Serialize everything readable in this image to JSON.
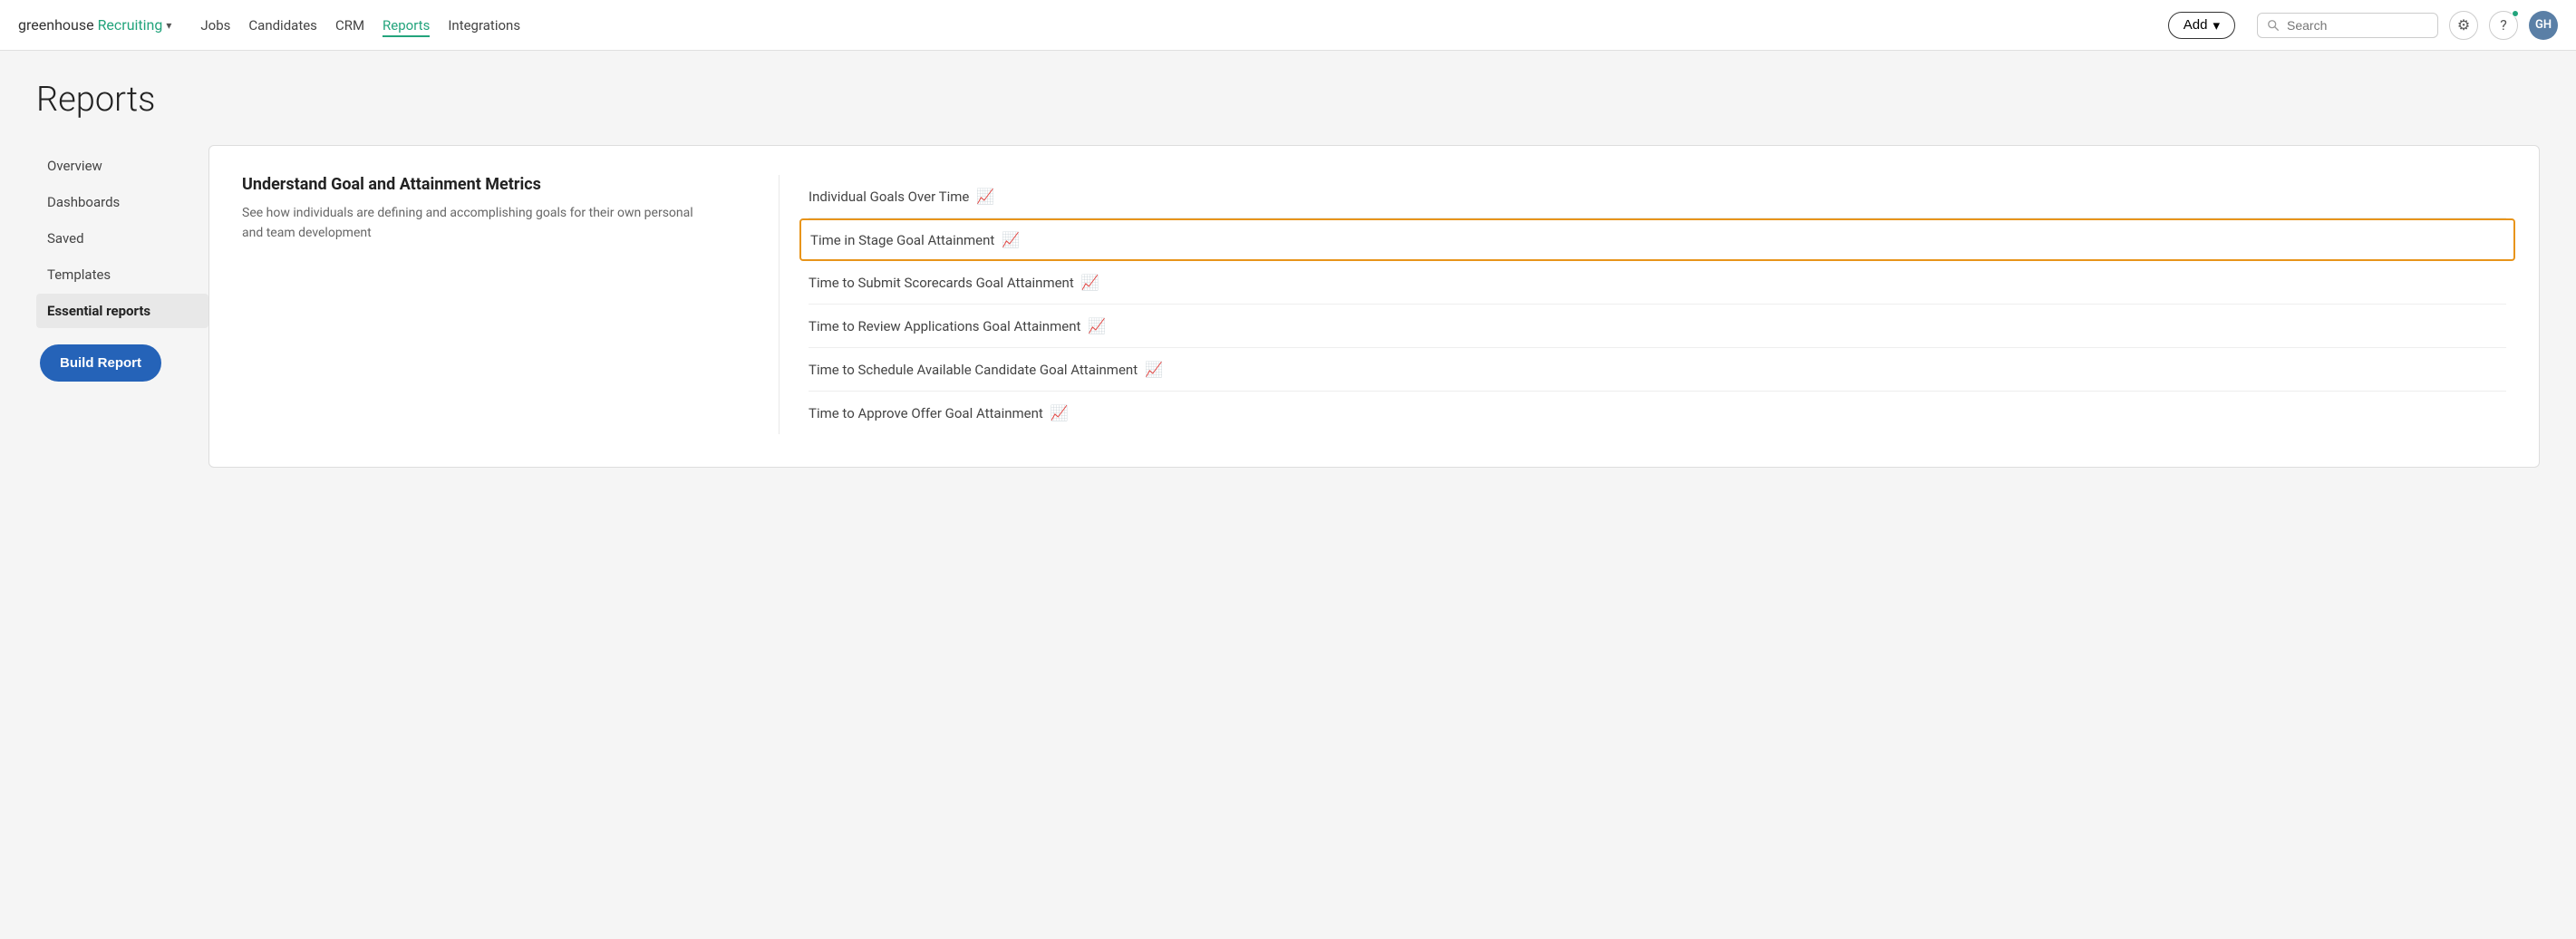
{
  "app": {
    "logo_greenhouse": "greenhouse",
    "logo_recruiting": "Recruiting",
    "logo_chevron": "▾"
  },
  "navbar": {
    "links": [
      {
        "label": "Jobs",
        "active": false
      },
      {
        "label": "Candidates",
        "active": false
      },
      {
        "label": "CRM",
        "active": false
      },
      {
        "label": "Reports",
        "active": true
      },
      {
        "label": "Integrations",
        "active": false
      }
    ],
    "add_button": "Add",
    "add_chevron": "▾",
    "search_placeholder": "Search",
    "gear_icon": "⚙",
    "help_icon": "?",
    "avatar_initials": "GH"
  },
  "page": {
    "title": "Reports"
  },
  "sidebar": {
    "items": [
      {
        "label": "Overview",
        "active": false
      },
      {
        "label": "Dashboards",
        "active": false
      },
      {
        "label": "Saved",
        "active": false
      },
      {
        "label": "Templates",
        "active": false
      },
      {
        "label": "Essential reports",
        "active": true
      }
    ],
    "build_report_label": "Build Report"
  },
  "main": {
    "section_title": "Understand Goal and Attainment Metrics",
    "section_desc_line1": "See how individuals are defining and accomplishing goals for their own personal",
    "section_desc_line2": "and team development",
    "report_items": [
      {
        "label": "Individual Goals Over Time",
        "highlighted": false
      },
      {
        "label": "Time in Stage Goal Attainment",
        "highlighted": true
      },
      {
        "label": "Time to Submit Scorecards Goal Attainment",
        "highlighted": false
      },
      {
        "label": "Time to Review Applications Goal Attainment",
        "highlighted": false
      },
      {
        "label": "Time to Schedule Available Candidate Goal Attainment",
        "highlighted": false
      },
      {
        "label": "Time to Approve Offer Goal Attainment",
        "highlighted": false
      }
    ]
  }
}
